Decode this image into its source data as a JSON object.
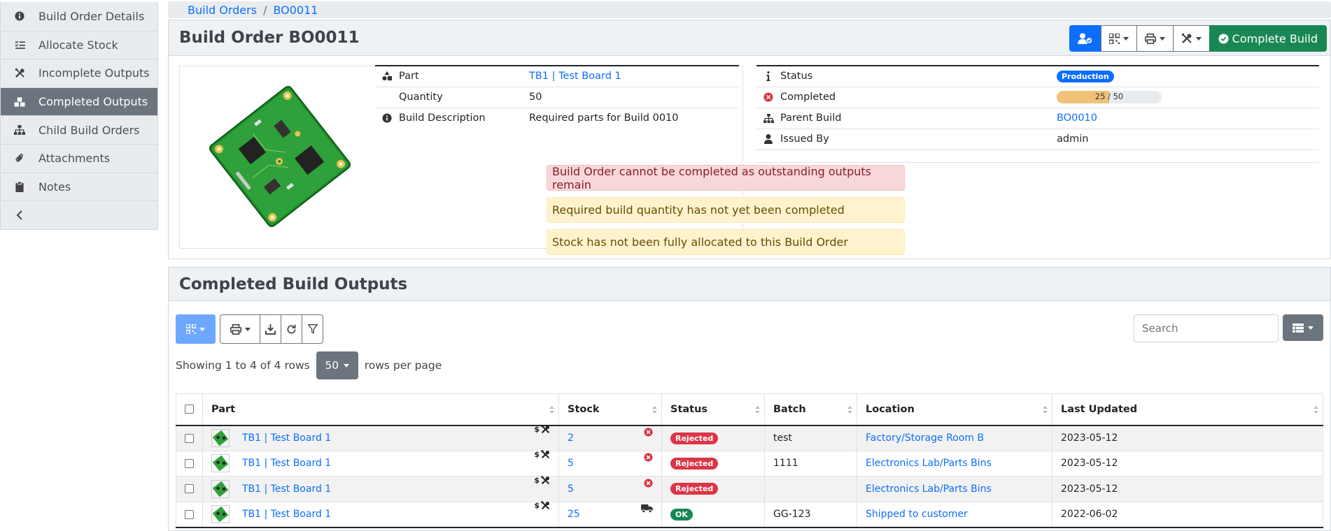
{
  "breadcrumb": {
    "items": [
      "Build Orders",
      "BO0011"
    ],
    "separator": "/"
  },
  "sidebar": {
    "items": [
      {
        "label": "Build Order Details",
        "icon": "info-circle-icon",
        "active": false
      },
      {
        "label": "Allocate Stock",
        "icon": "tasks-icon",
        "active": false
      },
      {
        "label": "Incomplete Outputs",
        "icon": "tools-icon",
        "active": false
      },
      {
        "label": "Completed Outputs",
        "icon": "boxes-icon",
        "active": true
      },
      {
        "label": "Child Build Orders",
        "icon": "sitemap-icon",
        "active": false
      },
      {
        "label": "Attachments",
        "icon": "paperclip-icon",
        "active": false
      },
      {
        "label": "Notes",
        "icon": "clipboard-icon",
        "active": false
      }
    ],
    "collapse_icon": "chevron-left-icon"
  },
  "header": {
    "title": "Build Order BO0011",
    "complete_button": "Complete Build",
    "toolbar_icons": [
      "user-check-icon",
      "qrcode-icon",
      "print-icon",
      "tools-icon",
      "check-circle-icon"
    ]
  },
  "details_left": [
    {
      "icon": "shapes-icon",
      "label": "Part",
      "value": "TB1 | Test Board 1",
      "link": true
    },
    {
      "icon": "",
      "label": "Quantity",
      "value": "50",
      "link": false
    },
    {
      "icon": "info-circle-icon",
      "label": "Build Description",
      "value": "Required parts for Build 0010",
      "link": false
    }
  ],
  "details_right": {
    "status": {
      "icon": "info-icon",
      "label": "Status",
      "badge": "Production"
    },
    "completed": {
      "icon": "times-circle-icon",
      "label": "Completed",
      "done": 25,
      "total": 50,
      "separator": " / "
    },
    "parent_build": {
      "icon": "sitemap-icon",
      "label": "Parent Build",
      "value": "BO0010"
    },
    "issued_by": {
      "icon": "user-icon",
      "label": "Issued By",
      "value": "admin"
    }
  },
  "alerts": {
    "danger": "Build Order cannot be completed as outstanding outputs remain",
    "warning1": "Required build quantity has not yet been completed",
    "warning2": "Stock has not been fully allocated to this Build Order"
  },
  "outputs": {
    "title": "Completed Build Outputs",
    "search_placeholder": "Search",
    "pagination": {
      "showing": "Showing 1 to 4 of 4 rows",
      "page_size": "50",
      "suffix": "rows per page"
    },
    "columns": [
      "Part",
      "Stock",
      "Status",
      "Batch",
      "Location",
      "Last Updated"
    ],
    "rows": [
      {
        "part": "TB1 | Test Board 1",
        "stock": "2",
        "stock_icon": "times-circle-icon",
        "status": "Rejected",
        "status_kind": "red",
        "batch": "test",
        "location": "Factory/Storage Room B",
        "updated": "2023-05-12"
      },
      {
        "part": "TB1 | Test Board 1",
        "stock": "5",
        "stock_icon": "times-circle-icon",
        "status": "Rejected",
        "status_kind": "red",
        "batch": "1111",
        "location": "Electronics Lab/Parts Bins",
        "updated": "2023-05-12"
      },
      {
        "part": "TB1 | Test Board 1",
        "stock": "5",
        "stock_icon": "times-circle-icon",
        "status": "Rejected",
        "status_kind": "red",
        "batch": "",
        "location": "Electronics Lab/Parts Bins",
        "updated": "2023-05-12"
      },
      {
        "part": "TB1 | Test Board 1",
        "stock": "25",
        "stock_icon": "truck-icon",
        "status": "OK",
        "status_kind": "green",
        "batch": "GG-123",
        "location": "Shipped to customer",
        "updated": "2022-06-02"
      }
    ],
    "part_icon_text": "$"
  }
}
